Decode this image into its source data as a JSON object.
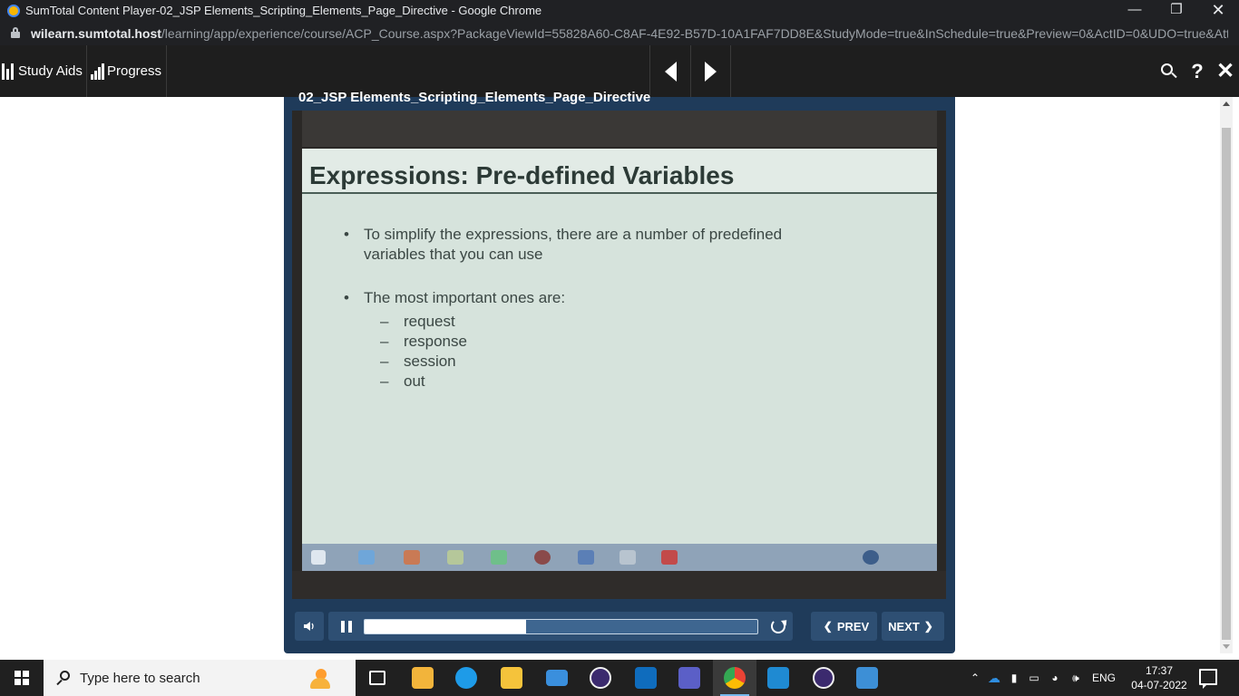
{
  "browser": {
    "window_title": "SumTotal Content Player-02_JSP Elements_Scripting_Elements_Page_Directive - Google Chrome",
    "url_host": "wilearn.sumtotal.host",
    "url_path": "/learning/app/experience/course/ACP_Course.aspx?PackageViewId=55828A60-C8AF-4E92-B57D-10A1FAF7DD8E&StudyMode=true&InSchedule=true&Preview=0&ActID=0&UDO=true&Att..."
  },
  "toolbar": {
    "study_aids_label": "Study Aids",
    "progress_label": "Progress",
    "help_label": "?",
    "close_label": "✕"
  },
  "player": {
    "course_title": "02_JSP Elements_Scripting_Elements_Page_Directive",
    "progress_fraction": 0.41,
    "prev_label": "PREV",
    "next_label": "NEXT"
  },
  "slide": {
    "title": "Expressions: Pre-defined Variables",
    "bullet1_line1": "To simplify the expressions, there are a number of predefined",
    "bullet1_line2": "variables that you can use",
    "bullet2": "The most important ones are:",
    "subitems": [
      "request",
      "response",
      "session",
      "out"
    ]
  },
  "taskbar": {
    "search_placeholder": "Type here to search",
    "language": "ENG",
    "time": "17:37",
    "date": "04-07-2022"
  },
  "colors": {
    "toolbar_bg": "#1e1e1e",
    "player_frame": "#1f3b5a",
    "control_bg": "#2e4f73",
    "slide_bg": "#d6e3dc"
  }
}
